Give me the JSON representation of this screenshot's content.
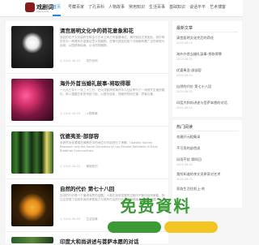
{
  "logo": {
    "name": "戏剧词",
    "sub": "xijuci.com"
  },
  "nav": [
    {
      "label": "首页",
      "active": true
    },
    {
      "label": "号藏百家"
    },
    {
      "label": "了孔百科"
    },
    {
      "label": "人物故事"
    },
    {
      "label": "常用知识"
    },
    {
      "label": "生活百事"
    },
    {
      "label": "基础知识"
    },
    {
      "label": "谈话平平"
    },
    {
      "label": "艺术博客"
    }
  ],
  "articles": [
    {
      "title": "清宫居明文化中的荷花意象和花",
      "excerpt": "宫廷的花卉文化始终在政治与艺术之间占有重要地位，清代宫廷尤其如此，其中荷花作为一种具有丰富象征意义的植物，在清代宫廷的各个方面都有着广泛的体现与运用，从园林到绘画，从诗词到器物。",
      "date": "2024-08-03",
      "category": "花卉百科"
    },
    {
      "title": "海外外首当婚礼鼓事-将取得罪",
      "excerpt": "一九九三年十一月二十三日，在大洋彼岸的海外华人社区举行了一场别开生面的婚礼，新人遵循古老的传统习俗，以鼓乐迎亲，场面热烈而庄重，宾客云集。",
      "date": "2024-08-03",
      "category": "人物故事"
    },
    {
      "title": "优婆夷圣-部部容",
      "excerpt": "本研究对优婆夷在佛教史中的地位与作用进行了考察。Upasika Sacred Research and the Social Dynamics of Lay Female Devotees in Early Buddhist Communities.",
      "date": "2024-08-03",
      "category": "常用知识"
    },
    {
      "title": "自然的代价 第七十八回",
      "excerpt": "自然的代价是一个值得深思的话题，人类在追求发展的过程中不断向自然索取，却往往忽视了自然本身的承受能力与其所付出的代价，本回继续讲述这一主题。",
      "date": "2024-08-03",
      "category": "生活百事"
    },
    {
      "title": "印度大和尚讲述与菩萨本愿的对话"
    }
  ],
  "side_recent": {
    "title": "最新文章",
    "items": [
      {
        "label": "清宫居明文化完后的荷花",
        "date": "2024-08-03"
      },
      {
        "label": "海外外首当婚礼鼓事-将取得罪",
        "date": "2024-08-03"
      },
      {
        "label": "优婆夷圣-部部容",
        "date": "2024-08-03"
      },
      {
        "label": "自然的代价 第七十八回",
        "date": "2024-08-03"
      },
      {
        "label": "印度大和尚讲述与菩萨本愿的对话",
        "date": "2024-08-03"
      }
    ]
  },
  "side_hot": {
    "title": "热门阅读",
    "items": [
      {
        "label": "花圃开元粗集录"
      },
      {
        "label": "不可用的部首说"
      },
      {
        "label": "风雨不扰 第四回",
        "date": "2024-08-03"
      },
      {
        "label": "我所知道的李文灵原家对艺术",
        "date": "2024-08-03"
      },
      {
        "label": "家族生活往前上-刻"
      }
    ]
  },
  "banner": {
    "text": "免费資料"
  },
  "colors": {
    "accent": "#1e88e5",
    "green": "#3a9b35",
    "yellow": "#f2c522"
  }
}
